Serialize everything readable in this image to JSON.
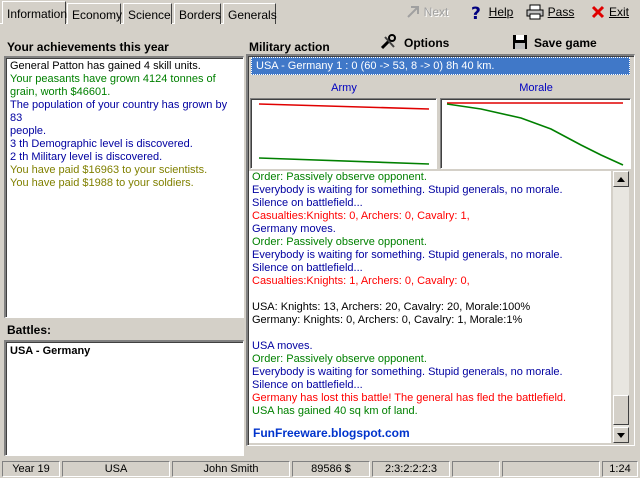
{
  "tabs": [
    "Information",
    "Economy",
    "Science",
    "Borders",
    "Generals"
  ],
  "toolbar": {
    "next": "Next",
    "help": "Help",
    "pass": "Pass",
    "exit": "Exit"
  },
  "achievements": {
    "title": "Your achievements this year",
    "lines": [
      {
        "text": "General Patton has gained 4 skill units.",
        "color": "black"
      },
      {
        "text": "Your peasants have grown 4124 tonnes of",
        "color": "green"
      },
      {
        "text": "grain, worth $46601.",
        "color": "green"
      },
      {
        "text": "The population of your country has grown by 83",
        "color": "blue"
      },
      {
        "text": "people.",
        "color": "blue"
      },
      {
        "text": "3 th Demographic level is discovered.",
        "color": "blue"
      },
      {
        "text": "2 th Military level is discovered.",
        "color": "blue"
      },
      {
        "text": "You have paid $16963 to your scientists.",
        "color": "olive"
      },
      {
        "text": "You have paid $1988 to your soldiers.",
        "color": "olive"
      }
    ]
  },
  "battles": {
    "title": "Battles:",
    "items": [
      "USA - Germany"
    ]
  },
  "military": {
    "title": "Military action",
    "options_label": "Options",
    "save_label": "Save game",
    "selected_battle": "USA - Germany  1 : 0 (60 -> 53, 8 -> 0) 8h 40 km.",
    "army_label": "Army",
    "morale_label": "Morale",
    "log": [
      {
        "text": "Order: Passively observe opponent.",
        "color": "green"
      },
      {
        "text": "Everybody is waiting for something. Stupid generals, no morale.",
        "color": "blue"
      },
      {
        "text": "Silence on battlefield...",
        "color": "blue"
      },
      {
        "text": "Casualties:Knights: 0, Archers: 0, Cavalry: 1,",
        "color": "red"
      },
      {
        "text": "Germany moves.",
        "color": "blue"
      },
      {
        "text": "Order: Passively observe opponent.",
        "color": "green"
      },
      {
        "text": "Everybody is waiting for something. Stupid generals, no morale.",
        "color": "blue"
      },
      {
        "text": "Silence on battlefield...",
        "color": "blue"
      },
      {
        "text": "Casualties:Knights: 1, Archers: 0, Cavalry: 0,",
        "color": "red"
      },
      {
        "text": "",
        "color": "black"
      },
      {
        "text": "USA: Knights: 13, Archers: 20, Cavalry: 20, Morale:100%",
        "color": "black"
      },
      {
        "text": "Germany: Knights: 0, Archers: 0, Cavalry: 1, Morale:1%",
        "color": "black"
      },
      {
        "text": "",
        "color": "black"
      },
      {
        "text": "USA moves.",
        "color": "blue"
      },
      {
        "text": "Order: Passively observe opponent.",
        "color": "green"
      },
      {
        "text": "Everybody is waiting for something. Stupid generals, no morale.",
        "color": "blue"
      },
      {
        "text": "Silence on battlefield...",
        "color": "blue"
      },
      {
        "text": "Germany has lost this battle! The general has fled the battlefield.",
        "color": "red"
      },
      {
        "text": "USA has gained 40 sq km of land.",
        "color": "green"
      }
    ],
    "watermark": "FunFreeware.blogspot.com"
  },
  "colors": {
    "black": "#000000",
    "green": "#008000",
    "blue": "#0000a0",
    "olive": "#808000",
    "red": "#ff0000",
    "watermark": "#0033cc"
  },
  "status": {
    "year": "Year 19",
    "country": "USA",
    "player": "John Smith",
    "money": "89586 $",
    "ratio": "2:3:2:2:2:3",
    "time": "1:24"
  }
}
